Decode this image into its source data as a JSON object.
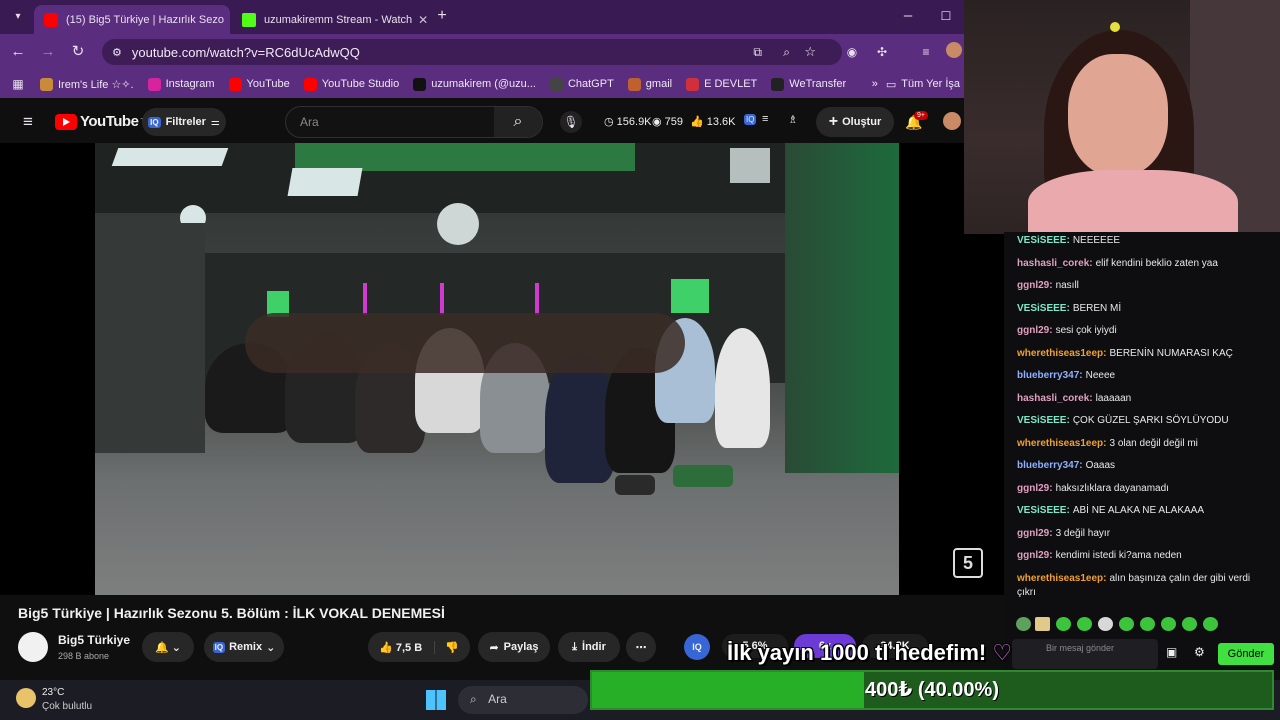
{
  "browser": {
    "tabs": [
      {
        "title": "(15) Big5 Türkiye | Hazırlık Sezo",
        "active": true,
        "favicon": "youtube-icon",
        "color": "#ff0000"
      },
      {
        "title": "uzumakiremm Stream - Watch",
        "active": false,
        "favicon": "kick-icon",
        "color": "#53fc18"
      }
    ],
    "url": "youtube.com/watch?v=RC6dUcAdwQQ",
    "bookmarks": [
      {
        "label": "Irem's Life ☆✧.",
        "color": "#c78b3a"
      },
      {
        "label": "Instagram",
        "color": "#d6249f"
      },
      {
        "label": "YouTube",
        "color": "#ff0000"
      },
      {
        "label": "YouTube Studio",
        "color": "#ff0000"
      },
      {
        "label": "uzumakirem (@uzu...",
        "color": "#111111"
      },
      {
        "label": "ChatGPT",
        "color": "#444444"
      },
      {
        "label": "gmail",
        "color": "#c06030"
      },
      {
        "label": "E DEVLET",
        "color": "#d0303a"
      },
      {
        "label": "WeTransfer",
        "color": "#222222"
      }
    ],
    "bookmarks_folder": "Tüm Yer İşa"
  },
  "youtube": {
    "logo": "YouTube",
    "region": "TR",
    "filters": "Filtreler",
    "search_placeholder": "Ara",
    "stats": {
      "views": "156.9K",
      "watching": "759",
      "likes": "13.6K"
    },
    "create": "Oluştur",
    "notif_count": "9+",
    "video_title": "Big5 Türkiye | Hazırlık Sezonu 5. Bölüm : İLK VOKAL DENEMESİ",
    "channel_name": "Big5 Türkiye",
    "subscribers": "298 B abone",
    "remix": "Remix",
    "likes": "7,5 B",
    "share": "Paylaş",
    "download": "İndir",
    "channel_badge": "5",
    "mini_stats": [
      "5.6%",
      "6x",
      "34.2K"
    ]
  },
  "chat": {
    "messages": [
      {
        "user": "VESiSEEE:",
        "text": "NEEEEEE",
        "color": "#7fe8c8"
      },
      {
        "user": "hashasli_corek:",
        "text": "elif kendini beklio zaten yaa",
        "color": "#e0a0c0"
      },
      {
        "user": "ggnl29:",
        "text": "nasıll",
        "color": "#e0a0c0"
      },
      {
        "user": "VESiSEEE:",
        "text": "BEREN Mİ",
        "color": "#7fe8c8"
      },
      {
        "user": "ggnl29:",
        "text": "sesi çok iyiydi",
        "color": "#e0a0c0"
      },
      {
        "user": "wherethiseas1eep:",
        "text": "BERENİN NUMARASI KAÇ",
        "color": "#f0a030"
      },
      {
        "user": "blueberry347:",
        "text": "Neeee",
        "color": "#8fb0ff"
      },
      {
        "user": "hashasli_corek:",
        "text": "laaaaan",
        "color": "#e0a0c0"
      },
      {
        "user": "VESiSEEE:",
        "text": "ÇOK GÜZEL ŞARKI SÖYLÜYODU",
        "color": "#7fe8c8"
      },
      {
        "user": "wherethiseas1eep:",
        "text": "3 olan değil değil mi",
        "color": "#f0a030"
      },
      {
        "user": "blueberry347:",
        "text": "Oaaas",
        "color": "#8fb0ff"
      },
      {
        "user": "ggnl29:",
        "text": "haksızlıklara dayanamadı",
        "color": "#e0a0c0"
      },
      {
        "user": "VESiSEEE:",
        "text": "ABİ NE ALAKA NE ALAKAAA",
        "color": "#7fe8c8"
      },
      {
        "user": "ggnl29:",
        "text": "3 değil hayır",
        "color": "#e0a0c0"
      },
      {
        "user": "ggnl29:",
        "text": "kendimi istedi ki?ama neden",
        "color": "#e0a0c0"
      },
      {
        "user": "wherethiseas1eep:",
        "text": "alın başınıza çalın der gibi verdi",
        "color": "#f0a030"
      }
    ],
    "last_line_cont": "çıkrı",
    "input_placeholder": "Bir mesaj gönder",
    "send": "Gönder"
  },
  "overlay": {
    "goal_text": "İlk yayın 1000 tl hedefim!",
    "goal_progress": 0.4,
    "goal_label": "400₺ (40.00%)"
  },
  "taskbar": {
    "temp": "23°C",
    "weather": "Çok bulutlu",
    "search": "Ara"
  }
}
